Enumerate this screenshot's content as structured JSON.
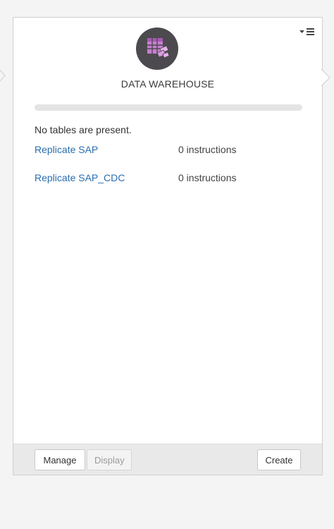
{
  "card": {
    "title": "DATA WAREHOUSE",
    "status_text": "No tables are present.",
    "progress_percent": 0,
    "logo_icon": "data-warehouse-table-icon",
    "accent_color": "#2a6eb0"
  },
  "tasks": [
    {
      "name": "Replicate SAP",
      "count": "0 instructions"
    },
    {
      "name": "Replicate SAP_CDC",
      "count": "0 instructions"
    }
  ],
  "footer": {
    "manage_label": "Manage",
    "display_label": "Display",
    "create_label": "Create"
  }
}
